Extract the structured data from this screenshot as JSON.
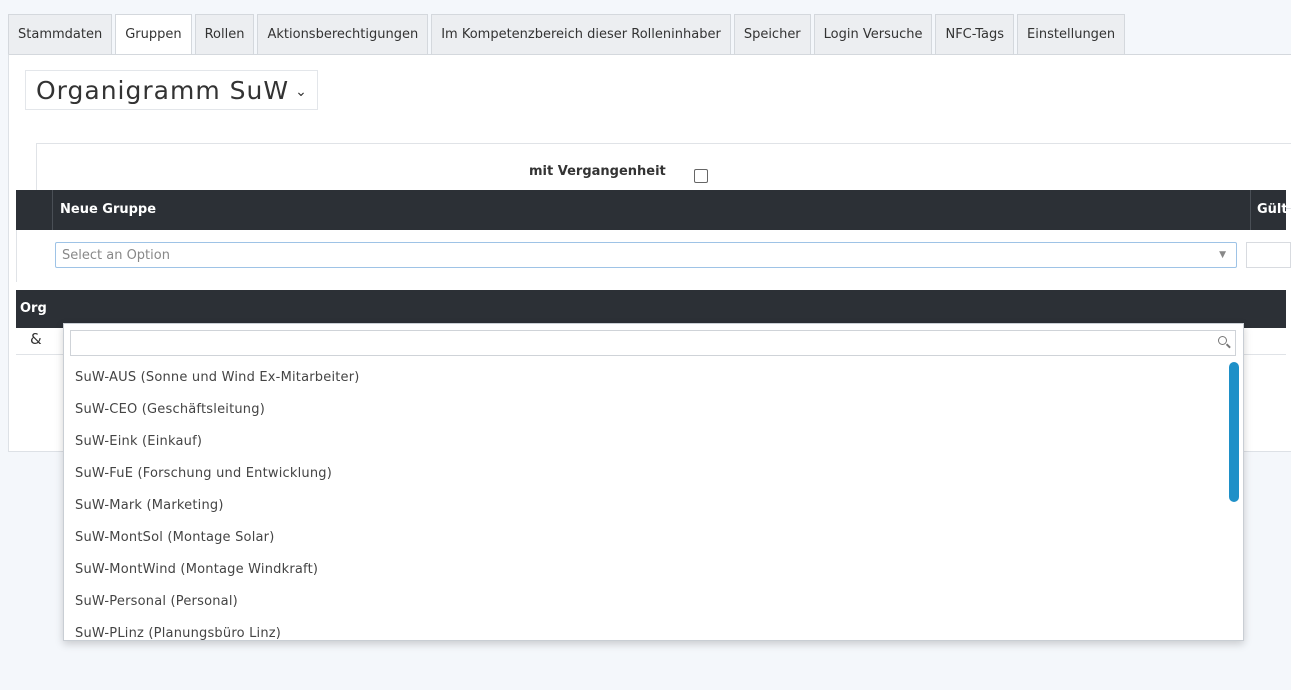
{
  "tabs": [
    {
      "label": "Stammdaten",
      "active": false
    },
    {
      "label": "Gruppen",
      "active": true
    },
    {
      "label": "Rollen",
      "active": false
    },
    {
      "label": "Aktionsberechtigungen",
      "active": false
    },
    {
      "label": "Im Kompetenzbereich dieser Rolleninhaber",
      "active": false
    },
    {
      "label": "Speicher",
      "active": false
    },
    {
      "label": "Login Versuche",
      "active": false
    },
    {
      "label": "NFC-Tags",
      "active": false
    },
    {
      "label": "Einstellungen",
      "active": false
    }
  ],
  "org_selector": {
    "value": "Organigramm SuW",
    "chevron": "⌄"
  },
  "filter": {
    "label": "mit Vergangenheit",
    "checked": false
  },
  "table": {
    "col_new_group": "Neue Gruppe",
    "col_valid": "Gült"
  },
  "group_select": {
    "placeholder": "Select an Option",
    "arrow": "▼",
    "options": [
      "SuW-AUS (Sonne und Wind Ex-Mitarbeiter)",
      "SuW-CEO (Geschäftsleitung)",
      "SuW-Eink (Einkauf)",
      "SuW-FuE (Forschung und Entwicklung)",
      "SuW-Mark (Marketing)",
      "SuW-MontSol (Montage Solar)",
      "SuW-MontWind (Montage Windkraft)",
      "SuW-Personal (Personal)",
      "SuW-PLinz (Planungsbüro Linz)"
    ]
  },
  "table2": {
    "col_org": "Org",
    "row_icon": "&"
  },
  "colors": {
    "header_bg": "#2c3036",
    "accent": "#1e90c8"
  }
}
